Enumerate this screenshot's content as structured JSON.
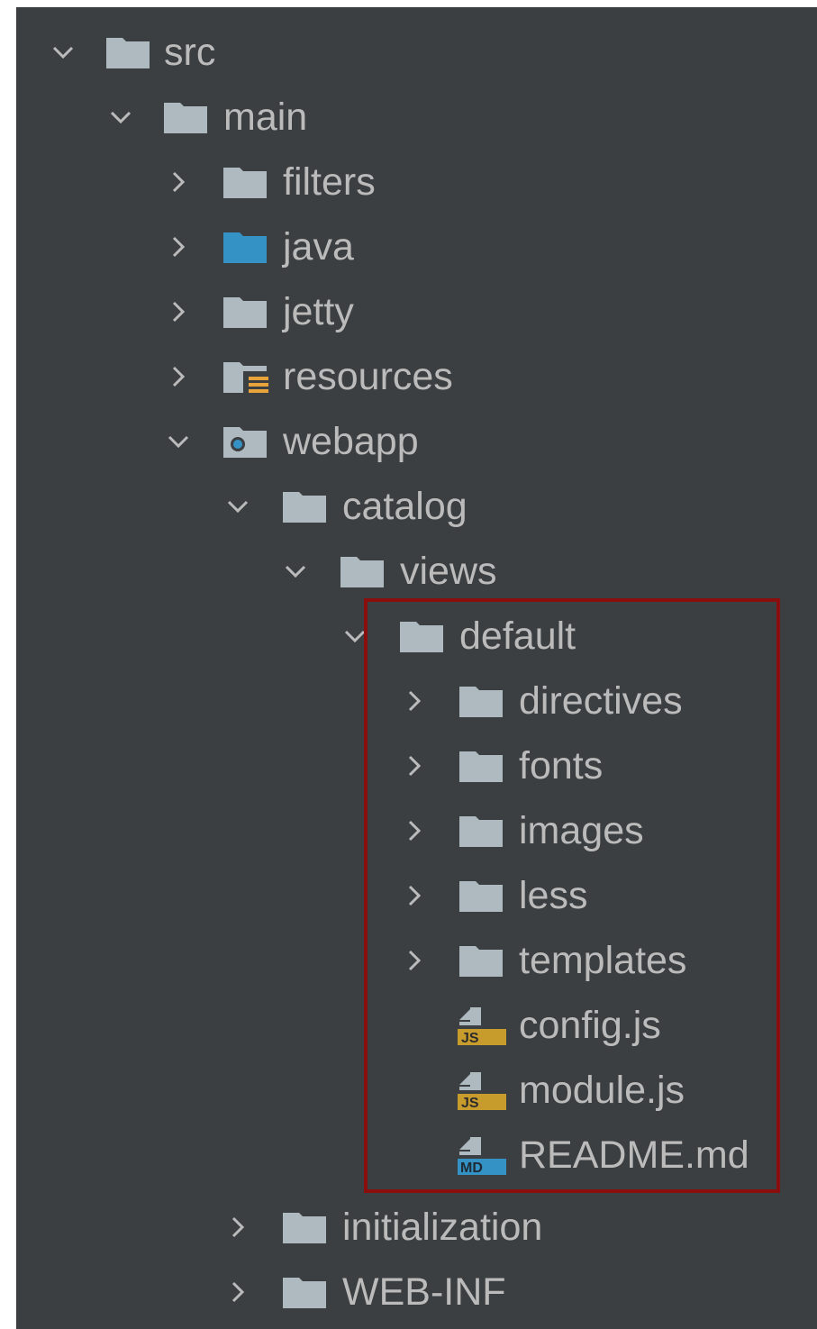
{
  "colors": {
    "panel_background": "#3c3f41",
    "text": "#bbbbbb",
    "folder": "#aeb9c0",
    "source_folder": "#3592c4",
    "resources_badge": "#e8a33d",
    "web_folder_dot": "#3592c4",
    "js_badge": "#c79c2d",
    "md_badge": "#3592c4",
    "highlight_border": "#8b0e0e"
  },
  "tree": {
    "items": [
      {
        "label": "src",
        "icon": "folder-icon",
        "expanded": true,
        "chevron": "chevron-down-icon"
      },
      {
        "label": "main",
        "icon": "folder-icon",
        "expanded": true,
        "chevron": "chevron-down-icon"
      },
      {
        "label": "filters",
        "icon": "folder-icon",
        "expanded": false,
        "chevron": "chevron-right-icon"
      },
      {
        "label": "java",
        "icon": "source-folder-icon",
        "expanded": false,
        "chevron": "chevron-right-icon"
      },
      {
        "label": "jetty",
        "icon": "folder-icon",
        "expanded": false,
        "chevron": "chevron-right-icon"
      },
      {
        "label": "resources",
        "icon": "resources-folder-icon",
        "expanded": false,
        "chevron": "chevron-right-icon"
      },
      {
        "label": "webapp",
        "icon": "web-folder-icon",
        "expanded": true,
        "chevron": "chevron-down-icon"
      },
      {
        "label": "catalog",
        "icon": "folder-icon",
        "expanded": true,
        "chevron": "chevron-down-icon"
      },
      {
        "label": "views",
        "icon": "folder-icon",
        "expanded": true,
        "chevron": "chevron-down-icon"
      },
      {
        "label": "default",
        "icon": "folder-icon",
        "expanded": true,
        "chevron": "chevron-down-icon"
      },
      {
        "label": "directives",
        "icon": "folder-icon",
        "expanded": false,
        "chevron": "chevron-right-icon"
      },
      {
        "label": "fonts",
        "icon": "folder-icon",
        "expanded": false,
        "chevron": "chevron-right-icon"
      },
      {
        "label": "images",
        "icon": "folder-icon",
        "expanded": false,
        "chevron": "chevron-right-icon"
      },
      {
        "label": "less",
        "icon": "folder-icon",
        "expanded": false,
        "chevron": "chevron-right-icon"
      },
      {
        "label": "templates",
        "icon": "folder-icon",
        "expanded": false,
        "chevron": "chevron-right-icon"
      },
      {
        "label": "config.js",
        "icon": "js-file-icon",
        "badge": "JS"
      },
      {
        "label": "module.js",
        "icon": "js-file-icon",
        "badge": "JS"
      },
      {
        "label": "README.md",
        "icon": "md-file-icon",
        "badge": "MD"
      },
      {
        "label": "initialization",
        "icon": "folder-icon",
        "expanded": false,
        "chevron": "chevron-right-icon"
      },
      {
        "label": "WEB-INF",
        "icon": "folder-icon",
        "expanded": false,
        "chevron": "chevron-right-icon"
      }
    ]
  }
}
